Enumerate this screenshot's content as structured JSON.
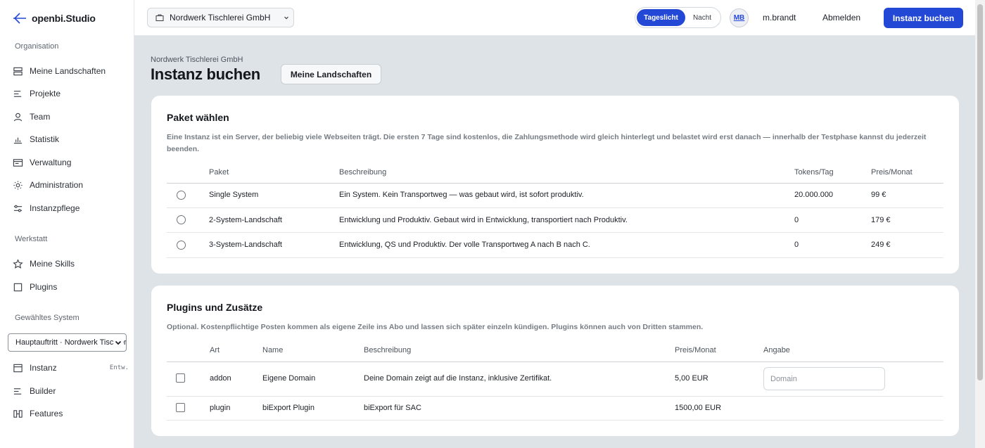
{
  "app": {
    "name": "openbi.Studio"
  },
  "sidebar": {
    "section_org": "Organisation",
    "org_items": [
      {
        "label": "Meine Landschaften",
        "icon": "stack-icon"
      },
      {
        "label": "Projekte",
        "icon": "list-icon"
      },
      {
        "label": "Team",
        "icon": "user-icon"
      },
      {
        "label": "Statistik",
        "icon": "bar-chart-icon"
      },
      {
        "label": "Verwaltung",
        "icon": "panel-icon"
      },
      {
        "label": "Administration",
        "icon": "sun-icon"
      },
      {
        "label": "Instanzpflege",
        "icon": "sliders-icon"
      }
    ],
    "section_workshop": "Werkstatt",
    "workshop_items": [
      {
        "label": "Meine Skills",
        "icon": "star-icon"
      },
      {
        "label": "Plugins",
        "icon": "square-icon"
      }
    ],
    "section_system": "Gewähltes System",
    "system_select": "Hauptauftritt · Nordwerk Tischlerei",
    "system_items": [
      {
        "label": "Instanz",
        "tag": "Entw.",
        "icon": "server-icon"
      },
      {
        "label": "Builder",
        "icon": "list-icon"
      },
      {
        "label": "Features",
        "icon": "blocks-icon"
      }
    ]
  },
  "topbar": {
    "org": "Nordwerk Tischlerei GmbH",
    "theme_light": "Tageslicht",
    "theme_dark": "Nacht",
    "avatar": "MB",
    "username": "m.brandt",
    "logout": "Abmelden",
    "primary": "Instanz buchen"
  },
  "page": {
    "breadcrumb": "Nordwerk Tischlerei GmbH",
    "title": "Instanz buchen",
    "secondary_button": "Meine Landschaften"
  },
  "packages": {
    "title": "Paket wählen",
    "description": "Eine Instanz ist ein Server, der beliebig viele Webseiten trägt. Die ersten 7 Tage sind kostenlos, die Zahlungsmethode wird gleich hinterlegt und belastet wird erst danach — innerhalb der Testphase kannst du jederzeit beenden.",
    "columns": {
      "paket": "Paket",
      "beschreibung": "Beschreibung",
      "tokens": "Tokens/Tag",
      "preis": "Preis/Monat"
    },
    "rows": [
      {
        "name": "Single System",
        "description": "Ein System. Kein Transportweg — was gebaut wird, ist sofort produktiv.",
        "tokens": "20.000.000",
        "price": "99 €"
      },
      {
        "name": "2-System-Landschaft",
        "description": "Entwicklung und Produktiv. Gebaut wird in Entwicklung, transportiert nach Produktiv.",
        "tokens": "0",
        "price": "179 €"
      },
      {
        "name": "3-System-Landschaft",
        "description": "Entwicklung, QS und Produktiv. Der volle Transportweg A nach B nach C.",
        "tokens": "0",
        "price": "249 €"
      }
    ]
  },
  "plugins": {
    "title": "Plugins und Zusätze",
    "description": "Optional. Kostenpflichtige Posten kommen als eigene Zeile ins Abo und lassen sich später einzeln kündigen. Plugins können auch von Dritten stammen.",
    "columns": {
      "art": "Art",
      "name": "Name",
      "beschreibung": "Beschreibung",
      "preis": "Preis/Monat",
      "angabe": "Angabe"
    },
    "rows": [
      {
        "type": "addon",
        "name": "Eigene Domain",
        "description": "Deine Domain zeigt auf die Instanz, inklusive Zertifikat.",
        "price": "5,00 EUR",
        "input_placeholder": "Domain"
      },
      {
        "type": "plugin",
        "name": "biExport Plugin",
        "description": "biExport für SAC",
        "price": "1500,00 EUR"
      }
    ]
  },
  "colors": {
    "accent": "#2348d6",
    "background": "#dde3e6"
  }
}
